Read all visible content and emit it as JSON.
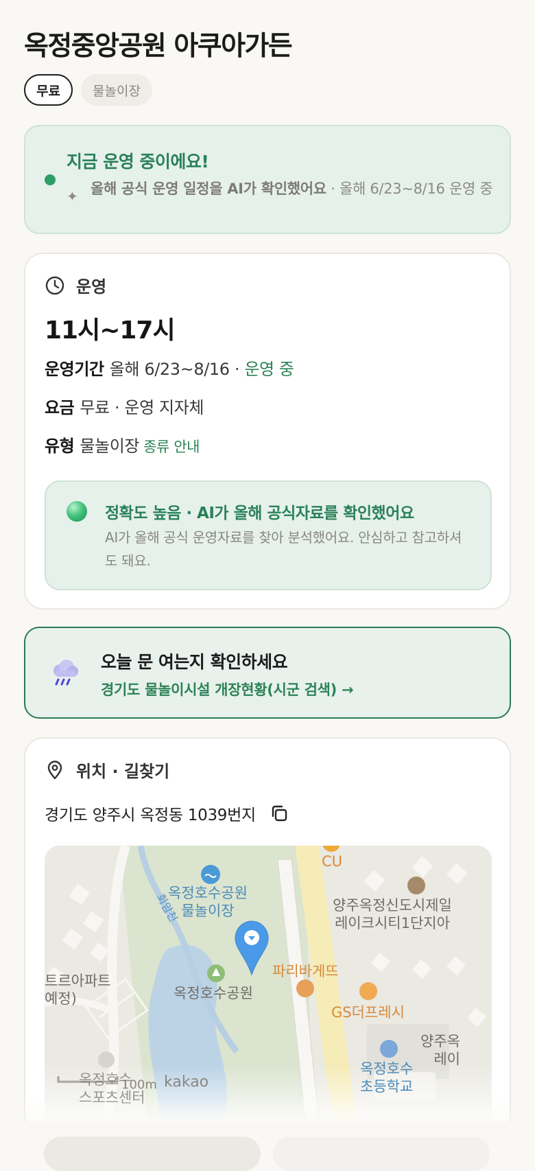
{
  "page": {
    "title": "옥정중앙공원 아쿠아가든",
    "chips": {
      "fee": "무료",
      "type": "물놀이장"
    }
  },
  "status": {
    "title": "지금 운영 중이에요!",
    "desc_bold": "올해 공식 운영 일정을 AI가 확인했어요",
    "desc_rest": " · 올해 6/23~8/16 운영 중"
  },
  "operation": {
    "section_title": "운영",
    "hours": "11시~17시",
    "period_label": "운영기간",
    "period_value": "올해 6/23~8/16 · ",
    "period_status": "운영 중",
    "fee_label": "요금",
    "fee_value": "무료 · 운영 지자체",
    "type_label": "유형",
    "type_value": "물놀이장",
    "type_link": "종류 안내",
    "accuracy_title": "정확도 높음 · AI가 올해 공식자료를 확인했어요",
    "accuracy_desc": "AI가 올해 공식 운영자료를 찾아 분석했어요. 안심하고 참고하셔도 돼요."
  },
  "notice": {
    "title": "오늘 문 여는지 확인하세요",
    "link": "경기도 물놀이시설 개장현황(시군 검색) →"
  },
  "location": {
    "section_title": "위치 · 길찾기",
    "address": "경기도 양주시 옥정동 1039번지",
    "map_labels": {
      "pool": "옥정호수공원\n물놀이장",
      "stream": "회암천",
      "park": "옥정호수공원",
      "cu": "CU",
      "apartment": "양주옥정신도시제일\n레이크시티1단지아",
      "bakery": "파리바게뜨",
      "gs": "GS더프레시",
      "apt_left": "트르아파트\n예정)",
      "school": "옥정호수\n초등학교",
      "right_edge": "양주옥\n레이",
      "sports": "옥정호수\n스포츠센터",
      "scale": "100m",
      "brand": "kakao"
    }
  },
  "colors": {
    "accent_green": "#2c8256",
    "status_bg": "#e6f1ec",
    "page_bg": "#f9f8f4"
  }
}
